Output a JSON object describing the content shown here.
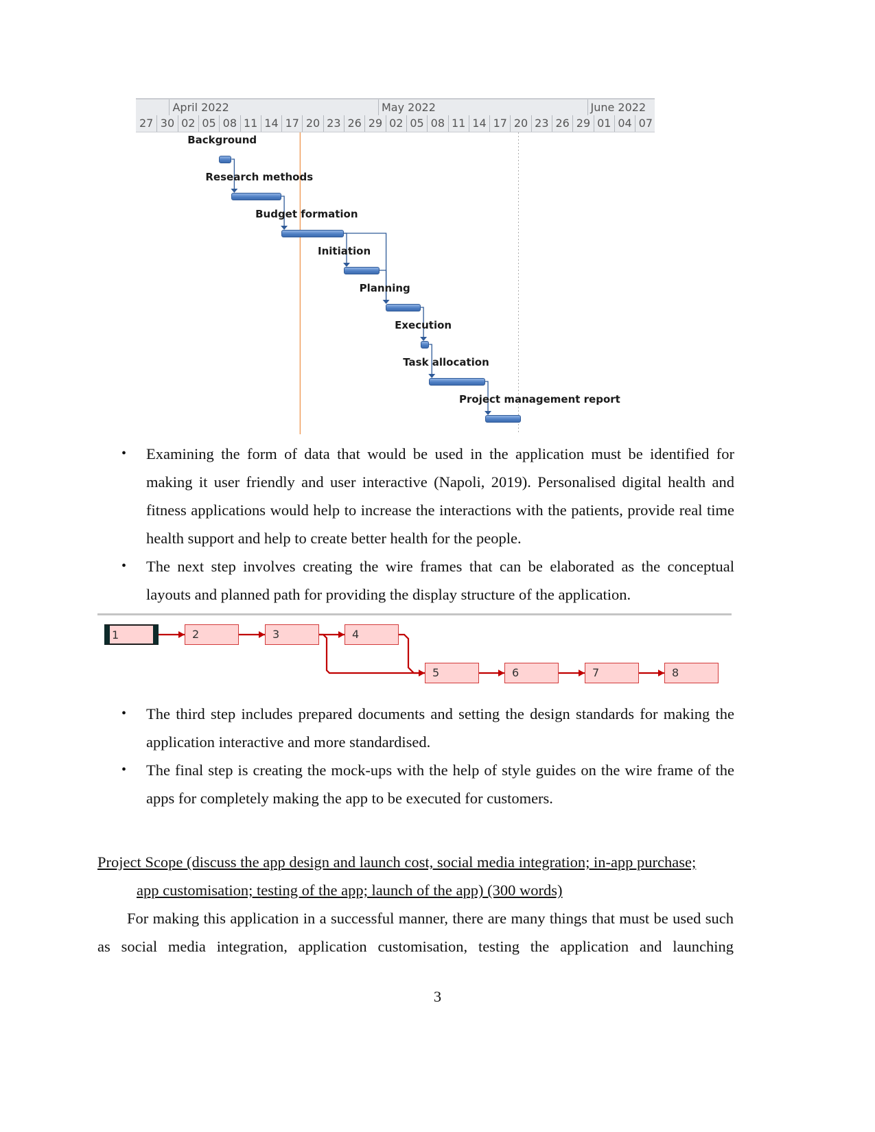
{
  "gantt": {
    "months": [
      {
        "label": "April 2022"
      },
      {
        "label": "May 2022"
      },
      {
        "label": "June 2022"
      }
    ],
    "days": [
      "27",
      "30",
      "02",
      "05",
      "08",
      "11",
      "14",
      "17",
      "20",
      "23",
      "26",
      "29",
      "02",
      "05",
      "08",
      "11",
      "14",
      "17",
      "20",
      "23",
      "26",
      "29",
      "01",
      "04",
      "07"
    ],
    "tasks": [
      {
        "name": "Background",
        "start": 4,
        "end": 4.6,
        "milestone": true
      },
      {
        "name": "Research methods",
        "start": 4.6,
        "end": 7
      },
      {
        "name": "Budget formation",
        "start": 7,
        "end": 10
      },
      {
        "name": "Initiation",
        "start": 10,
        "end": 11.7
      },
      {
        "name": "Planning",
        "start": 12,
        "end": 13.7
      },
      {
        "name": "Execution",
        "start": 13.7,
        "end": 14.1,
        "milestone": true
      },
      {
        "name": "Task allocation",
        "start": 14.1,
        "end": 16.8
      },
      {
        "name": "Project management report",
        "start": 16.8,
        "end": 18.5
      }
    ],
    "today_marker_day_index": 8,
    "colors": {
      "bar": "#4f7fc4",
      "link": "#2f5a98",
      "today": "#f0a060"
    }
  },
  "bullets_1": [
    {
      "text": "Examining the form of data that would be used in the application must be identified for making it user friendly and user interactive (Napoli, 2019). Personalised digital health and fitness applications would help to increase the interactions with the patients, provide real time health support and help to create better health for the people."
    },
    {
      "text": "The next step involves creating the wire frames that can be elaborated as the conceptual layouts and planned path for providing the display structure of the application."
    }
  ],
  "network": {
    "nodes": [
      {
        "label": "1"
      },
      {
        "label": "2"
      },
      {
        "label": "3"
      },
      {
        "label": "4"
      },
      {
        "label": "5"
      },
      {
        "label": "6"
      },
      {
        "label": "7"
      },
      {
        "label": "8"
      }
    ],
    "edges": [
      [
        "1",
        "2"
      ],
      [
        "2",
        "3"
      ],
      [
        "3",
        "4"
      ],
      [
        "3",
        "5"
      ],
      [
        "4",
        "5"
      ],
      [
        "5",
        "6"
      ],
      [
        "6",
        "7"
      ],
      [
        "7",
        "8"
      ]
    ],
    "colors": {
      "box_fill": "#ffd4d4",
      "box_border": "#d23a3a",
      "arrow": "#c00000"
    }
  },
  "bullets_2": [
    {
      "text": "The third step includes prepared documents and setting the design standards for making the application interactive and more standardised."
    },
    {
      "text": "The final step is creating the mock-ups with the help of style guides on the wire frame of the apps for completely making the app to be executed for customers."
    }
  ],
  "heading": {
    "line1": "Project Scope (discuss the app design and launch cost, social media integration; in-app purchase;",
    "line2": "app customisation; testing of the app; launch of the app) (300 words) "
  },
  "paragraph": "For making this application in a successful manner, there are many things that must be used such as social media integration, application customisation, testing the application and launching",
  "page_number": "3",
  "bullet_glyph": "•"
}
